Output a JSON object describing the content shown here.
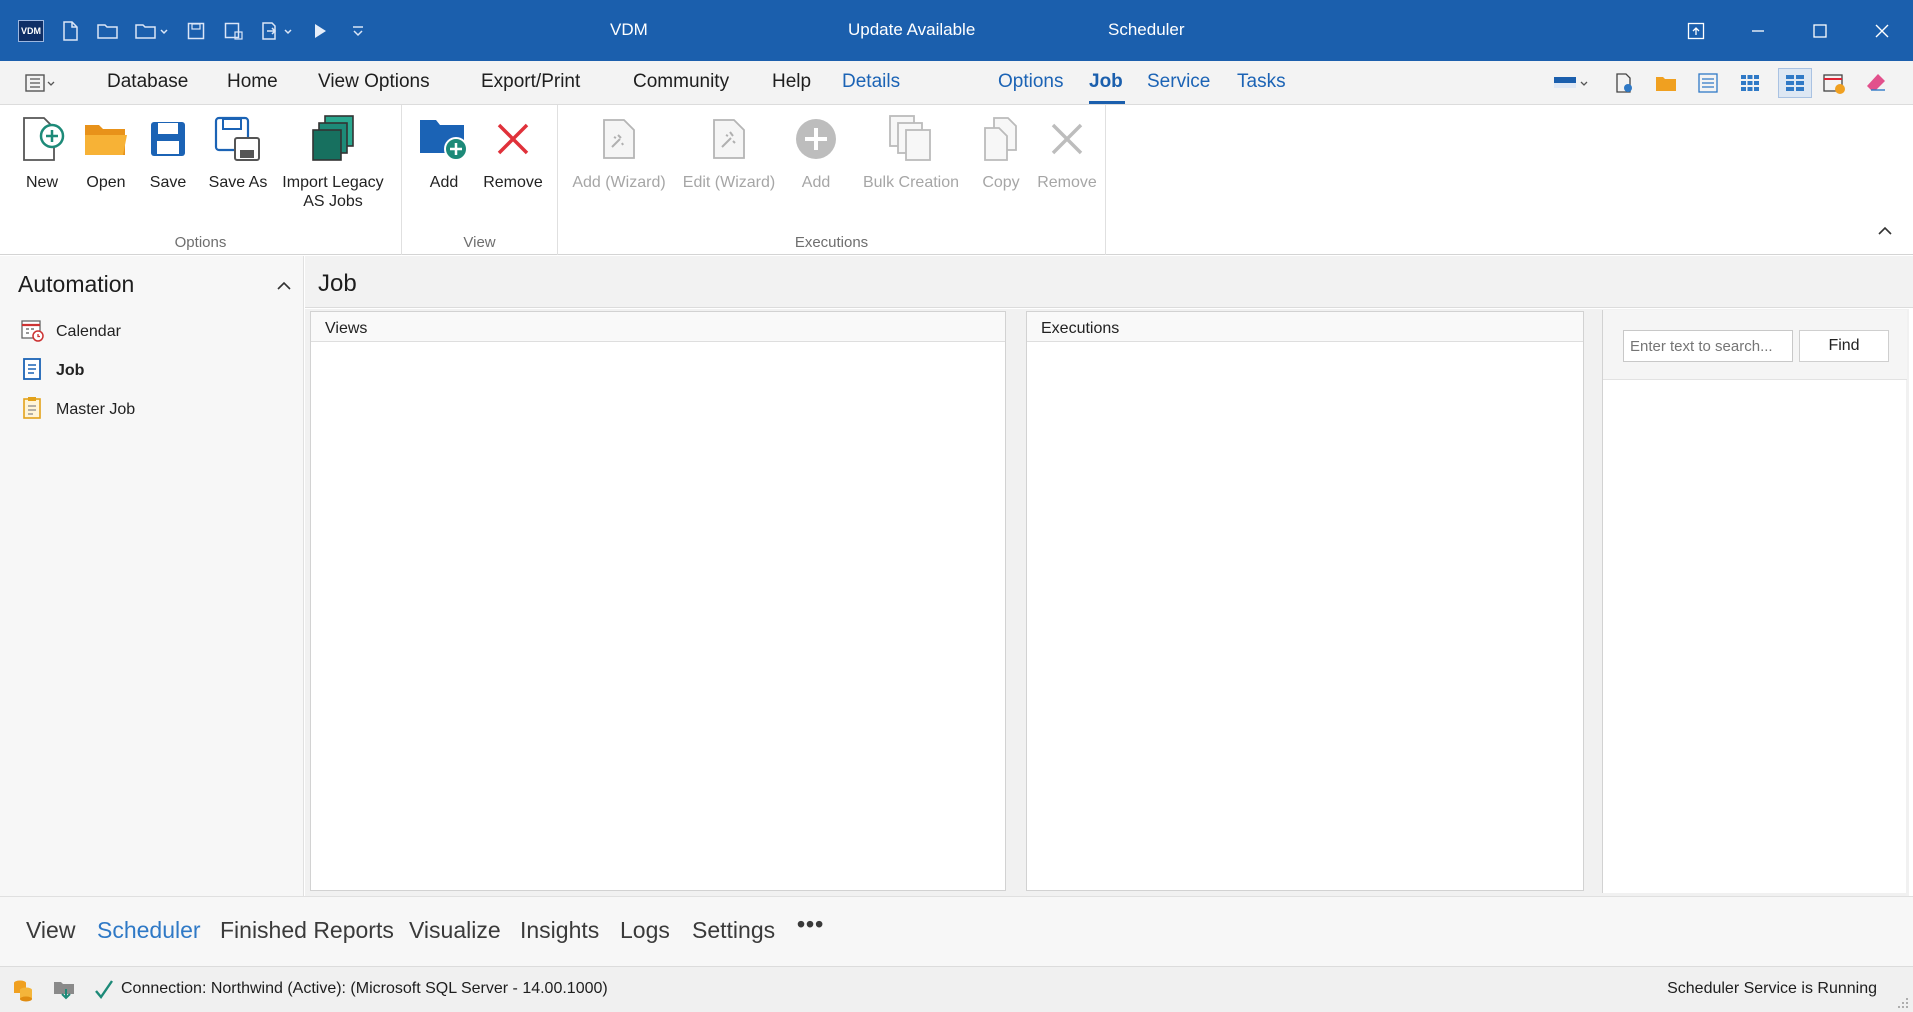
{
  "titlebar": {
    "logo_text": "VDM",
    "app_title": "VDM",
    "update_text": "Update Available",
    "module_title": "Scheduler"
  },
  "menu": {
    "items": [
      "Database",
      "Home",
      "View Options",
      "Export/Print",
      "Community",
      "Help"
    ],
    "context_items": [
      "Details",
      "Options",
      "Job",
      "Service",
      "Tasks"
    ],
    "active": "Job"
  },
  "ribbon": {
    "groups": {
      "options": {
        "label": "Options",
        "buttons": [
          "New",
          "Open",
          "Save",
          "Save As",
          "Import Legacy\nAS Jobs"
        ]
      },
      "view": {
        "label": "View",
        "buttons": [
          "Add",
          "Remove"
        ]
      },
      "executions": {
        "label": "Executions",
        "buttons": [
          "Add (Wizard)",
          "Edit (Wizard)",
          "Add",
          "Bulk Creation",
          "Copy",
          "Remove"
        ]
      }
    }
  },
  "leftnav": {
    "header": "Automation",
    "items": [
      {
        "label": "Calendar",
        "icon": "calendar-icon"
      },
      {
        "label": "Job",
        "icon": "job-icon"
      },
      {
        "label": "Master Job",
        "icon": "master-job-icon"
      }
    ],
    "selected": "Job"
  },
  "main": {
    "title": "Job",
    "views_panel": "Views",
    "executions_panel": "Executions",
    "search": {
      "placeholder": "Enter text to search...",
      "button": "Find"
    }
  },
  "bottomtabs": {
    "items": [
      "View",
      "Scheduler",
      "Finished Reports",
      "Visualize",
      "Insights",
      "Logs",
      "Settings"
    ],
    "active": "Scheduler",
    "more": "•••"
  },
  "statusbar": {
    "connection": "Connection: Northwind (Active): (Microsoft SQL Server - 14.00.1000)",
    "service": "Scheduler Service is Running"
  },
  "colors": {
    "titlebar": "#1b5fad",
    "accent": "#1b5fad",
    "active_bottom_tab": "#2f79c6",
    "remove_red": "#e0313a",
    "teal": "#1d8a78"
  }
}
